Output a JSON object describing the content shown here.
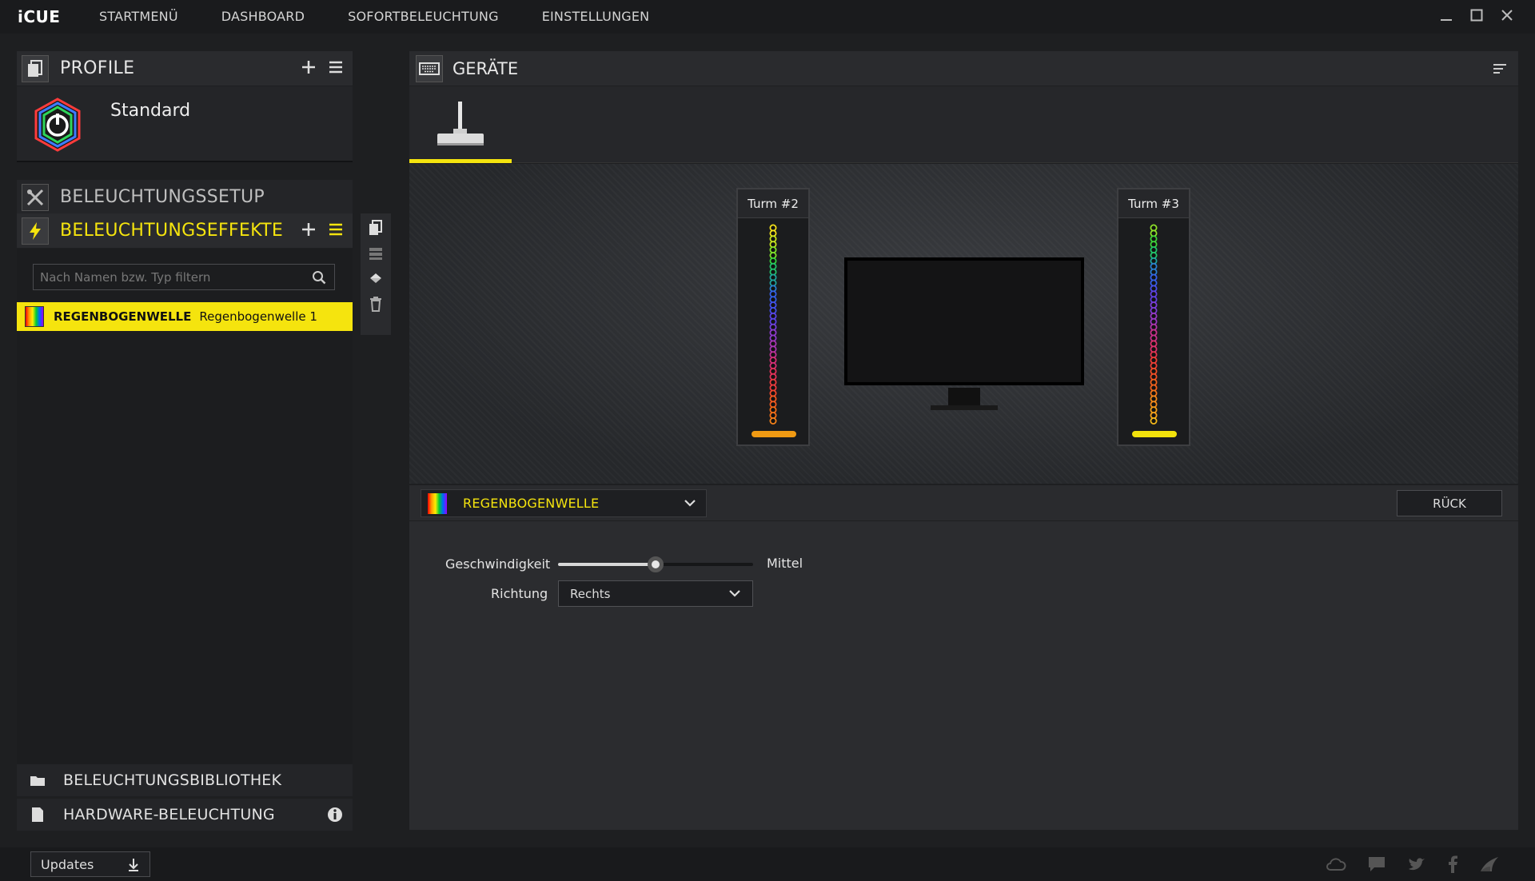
{
  "app": {
    "logo": "iCUE",
    "nav": [
      "STARTMENÜ",
      "DASHBOARD",
      "SOFORTBELEUCHTUNG",
      "EINSTELLUNGEN"
    ]
  },
  "profile": {
    "title": "PROFILE",
    "name": "Standard"
  },
  "lighting": {
    "setup_title": "BELEUCHTUNGSSETUP",
    "effects_title": "BELEUCHTUNGSEFFEKTE",
    "filter_placeholder": "Nach Namen bzw. Typ filtern",
    "effects": [
      {
        "type": "REGENBOGENWELLE",
        "name": "Regenbogenwelle 1"
      }
    ],
    "library_title": "BELEUCHTUNGSBIBLIOTHEK",
    "hardware_title": "HARDWARE-BELEUCHTUNG"
  },
  "devices": {
    "title": "GERÄTE",
    "towers": [
      "Turm #2",
      "Turm #3"
    ]
  },
  "effect_editor": {
    "selected_effect": "REGENBOGENWELLE",
    "back_label": "RÜCK",
    "speed_label": "Geschwindigkeit",
    "speed_value_label": "Mittel",
    "speed_fraction": 0.5,
    "direction_label": "Richtung",
    "direction_value": "Rechts"
  },
  "footer": {
    "updates_label": "Updates"
  },
  "colors": {
    "accent": "#f5e40e",
    "background": "#1e1f21",
    "panel": "#2a2b2e"
  }
}
